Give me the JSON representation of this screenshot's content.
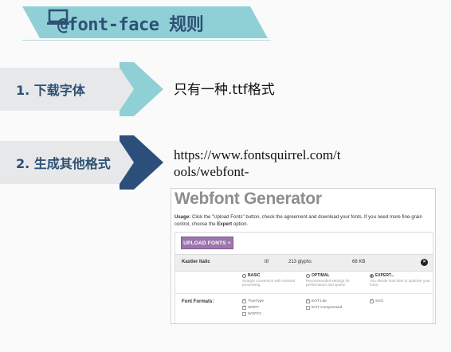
{
  "title": {
    "text": "@font-face 规则",
    "icon": "laptop-icon"
  },
  "steps": [
    {
      "label": "1. 下载字体",
      "description": "只有一种.ttf格式"
    },
    {
      "label": "2. 生成其他格式",
      "description": "https://www.fontsquirrel.com/tools/webfont-"
    }
  ],
  "generator": {
    "title": "Webfont Generator",
    "usage_prefix": "Usage:",
    "usage_text": " Click the \"Upload Fonts\" button, check the agreement and download your fonts. If you need more fine-grain control, choose the ",
    "usage_bold": "Expert",
    "usage_suffix": " option.",
    "upload_button": "UPLOAD FONTS +",
    "font_row": {
      "name": "Kastler Italic",
      "format": "ttf",
      "glyphs": "213 glyphs",
      "size": "68 KB"
    },
    "modes": [
      {
        "name": "BASIC",
        "desc": "Straight conversion with minimal processing.",
        "selected": false
      },
      {
        "name": "OPTIMAL",
        "desc": "Recommended settings for performance and speed.",
        "selected": false
      },
      {
        "name": "EXPERT...",
        "desc": "You decide how best to optimize your fonts.",
        "selected": true
      }
    ],
    "formats_label": "Font Formats:",
    "formats": [
      {
        "name": "TrueType",
        "checked": true
      },
      {
        "name": "WOFF",
        "checked": true
      },
      {
        "name": "WOFF2",
        "checked": false
      },
      {
        "name": "EOT Lite",
        "checked": true
      },
      {
        "name": "EOT Compressed",
        "checked": false
      },
      {
        "name": "SVG",
        "checked": true
      }
    ]
  },
  "colors": {
    "teal": "#8fd0d6",
    "navy": "#2b4f7a",
    "text_dark": "#2e5174",
    "purple_button": "#9c76ad"
  }
}
